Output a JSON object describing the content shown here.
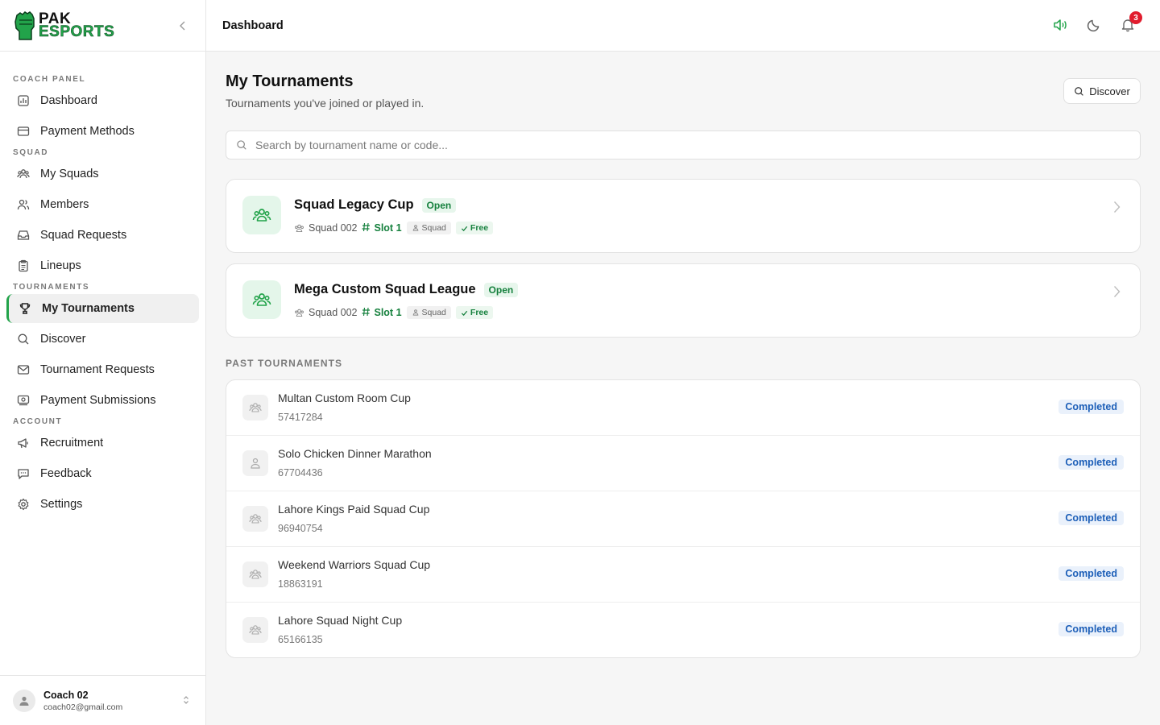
{
  "brand": {
    "line1": "PAK",
    "line2": "ESPORTS"
  },
  "sidebar": {
    "groups": [
      {
        "label": "COACH PANEL",
        "items": [
          {
            "label": "Dashboard",
            "icon": "chart-icon"
          },
          {
            "label": "Payment Methods",
            "icon": "credit-card-icon"
          }
        ]
      },
      {
        "label": "SQUAD",
        "items": [
          {
            "label": "My Squads",
            "icon": "users-icon"
          },
          {
            "label": "Members",
            "icon": "user-group-icon"
          },
          {
            "label": "Squad Requests",
            "icon": "inbox-icon"
          },
          {
            "label": "Lineups",
            "icon": "clipboard-icon"
          }
        ]
      },
      {
        "label": "TOURNAMENTS",
        "items": [
          {
            "label": "My Tournaments",
            "icon": "trophy-icon"
          },
          {
            "label": "Discover",
            "icon": "search-icon"
          },
          {
            "label": "Tournament Requests",
            "icon": "mail-icon"
          },
          {
            "label": "Payment Submissions",
            "icon": "receipt-icon"
          }
        ]
      },
      {
        "label": "ACCOUNT",
        "items": [
          {
            "label": "Recruitment",
            "icon": "megaphone-icon"
          },
          {
            "label": "Feedback",
            "icon": "message-icon"
          },
          {
            "label": "Settings",
            "icon": "gear-icon"
          }
        ]
      }
    ],
    "user": {
      "name": "Coach 02",
      "email": "coach02@gmail.com"
    }
  },
  "header": {
    "title": "Dashboard",
    "notification_count": "3"
  },
  "page": {
    "title": "My Tournaments",
    "subtitle": "Tournaments you've joined or played in.",
    "discover_label": "Discover",
    "search_placeholder": "Search by tournament name or code..."
  },
  "active_tournaments": [
    {
      "name": "Squad Legacy Cup",
      "status": "Open",
      "squad": "Squad 002",
      "slot": "Slot 1",
      "mode": "Squad",
      "fee": "Free"
    },
    {
      "name": "Mega Custom Squad League",
      "status": "Open",
      "squad": "Squad 002",
      "slot": "Slot 1",
      "mode": "Squad",
      "fee": "Free"
    }
  ],
  "past_label": "PAST TOURNAMENTS",
  "past_tournaments": [
    {
      "name": "Multan Custom Room Cup",
      "code": "57417284",
      "status": "Completed",
      "icon": "users-icon"
    },
    {
      "name": "Solo Chicken Dinner Marathon",
      "code": "67704436",
      "status": "Completed",
      "icon": "user-icon"
    },
    {
      "name": "Lahore Kings Paid Squad Cup",
      "code": "96940754",
      "status": "Completed",
      "icon": "users-icon"
    },
    {
      "name": "Weekend Warriors Squad Cup",
      "code": "18863191",
      "status": "Completed",
      "icon": "users-icon"
    },
    {
      "name": "Lahore Squad Night Cup",
      "code": "65166135",
      "status": "Completed",
      "icon": "users-icon"
    }
  ],
  "colors": {
    "accent": "#22a34a",
    "completed": "#1d5fb8",
    "badge": "#e11d2e"
  }
}
